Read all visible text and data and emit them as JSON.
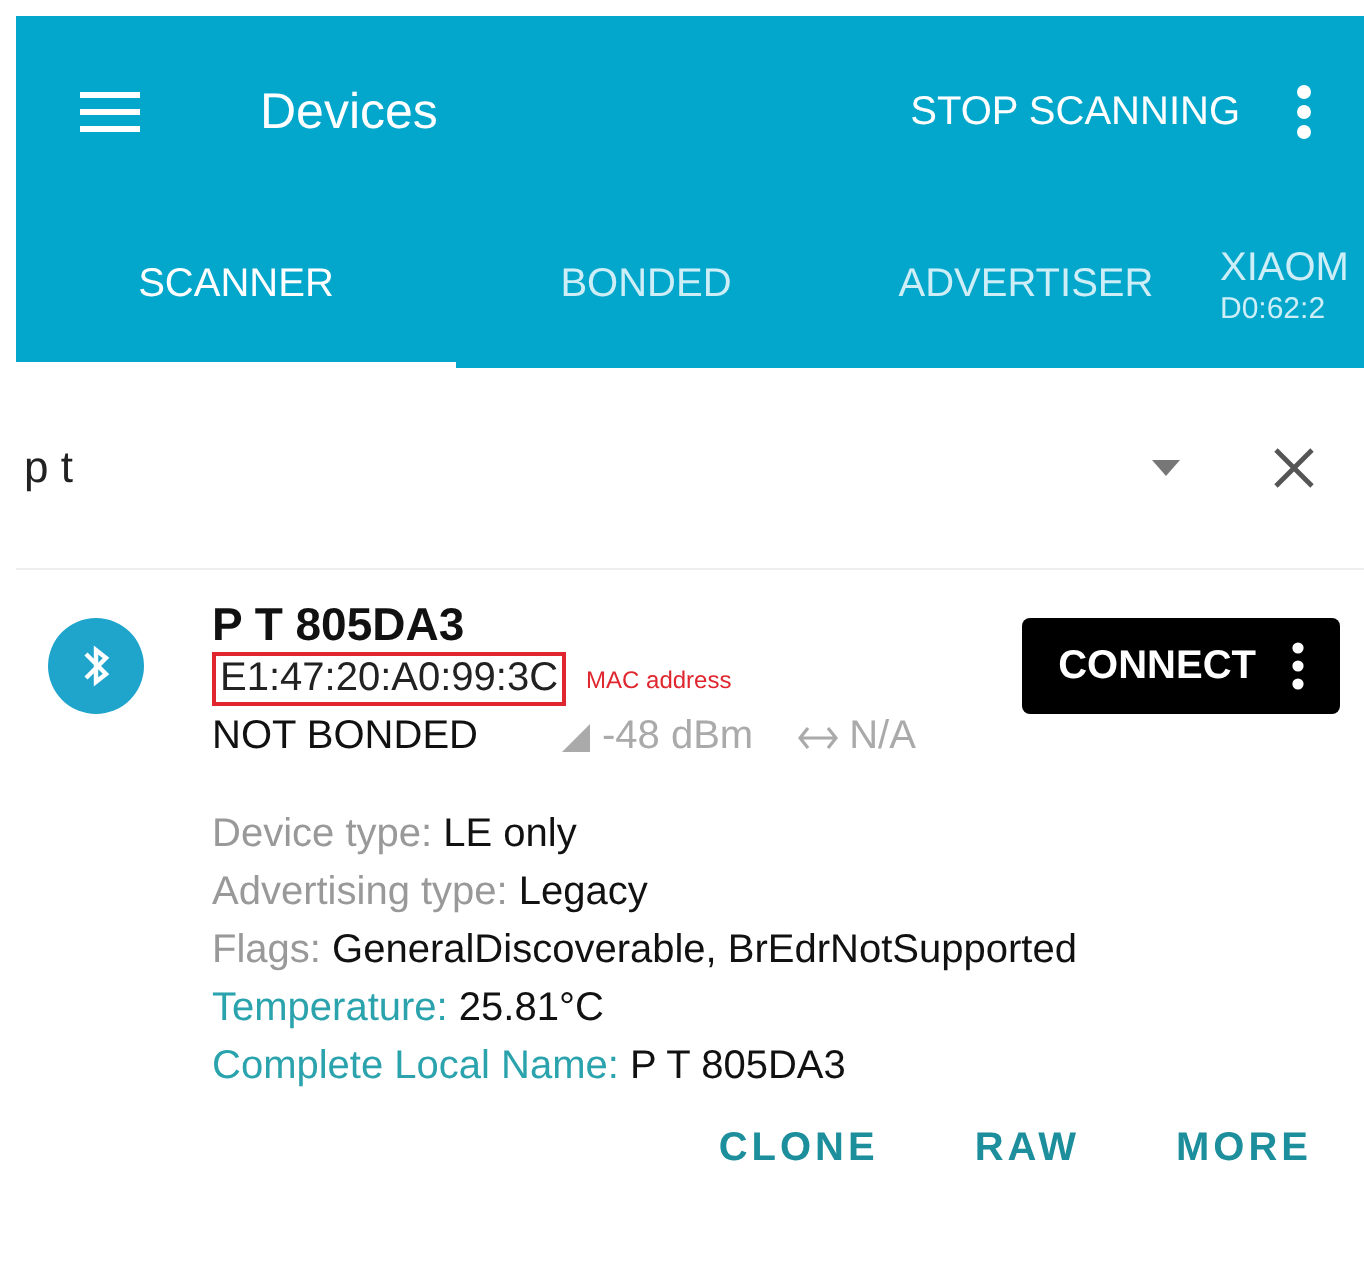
{
  "app_bar": {
    "title": "Devices",
    "action": "STOP SCANNING"
  },
  "tabs": [
    {
      "label": "SCANNER",
      "selected": true
    },
    {
      "label": "BONDED",
      "selected": false
    },
    {
      "label": "ADVERTISER",
      "selected": false
    },
    {
      "label": "XIAOM",
      "sublabel": "D0:62:2",
      "selected": false
    }
  ],
  "filter": {
    "value": "p t"
  },
  "device": {
    "name": "P T 805DA3",
    "mac": "E1:47:20:A0:99:3C",
    "mac_highlighted": true,
    "annotation": "MAC address",
    "bond_state": "NOT BONDED",
    "rssi": "-48 dBm",
    "interval": "N/A",
    "connect": "CONNECT",
    "details": [
      {
        "kind": "property",
        "label": "Device type:",
        "value": "LE only"
      },
      {
        "kind": "property",
        "label": "Advertising type:",
        "value": "Legacy"
      },
      {
        "kind": "property",
        "label": "Flags:",
        "value": "GeneralDiscoverable, BrEdrNotSupported"
      },
      {
        "kind": "service",
        "label": "Temperature:",
        "value": "25.81°C"
      },
      {
        "kind": "service",
        "label": "Complete Local Name:",
        "value": "P T 805DA3"
      }
    ],
    "actions": [
      "CLONE",
      "RAW",
      "MORE"
    ]
  }
}
